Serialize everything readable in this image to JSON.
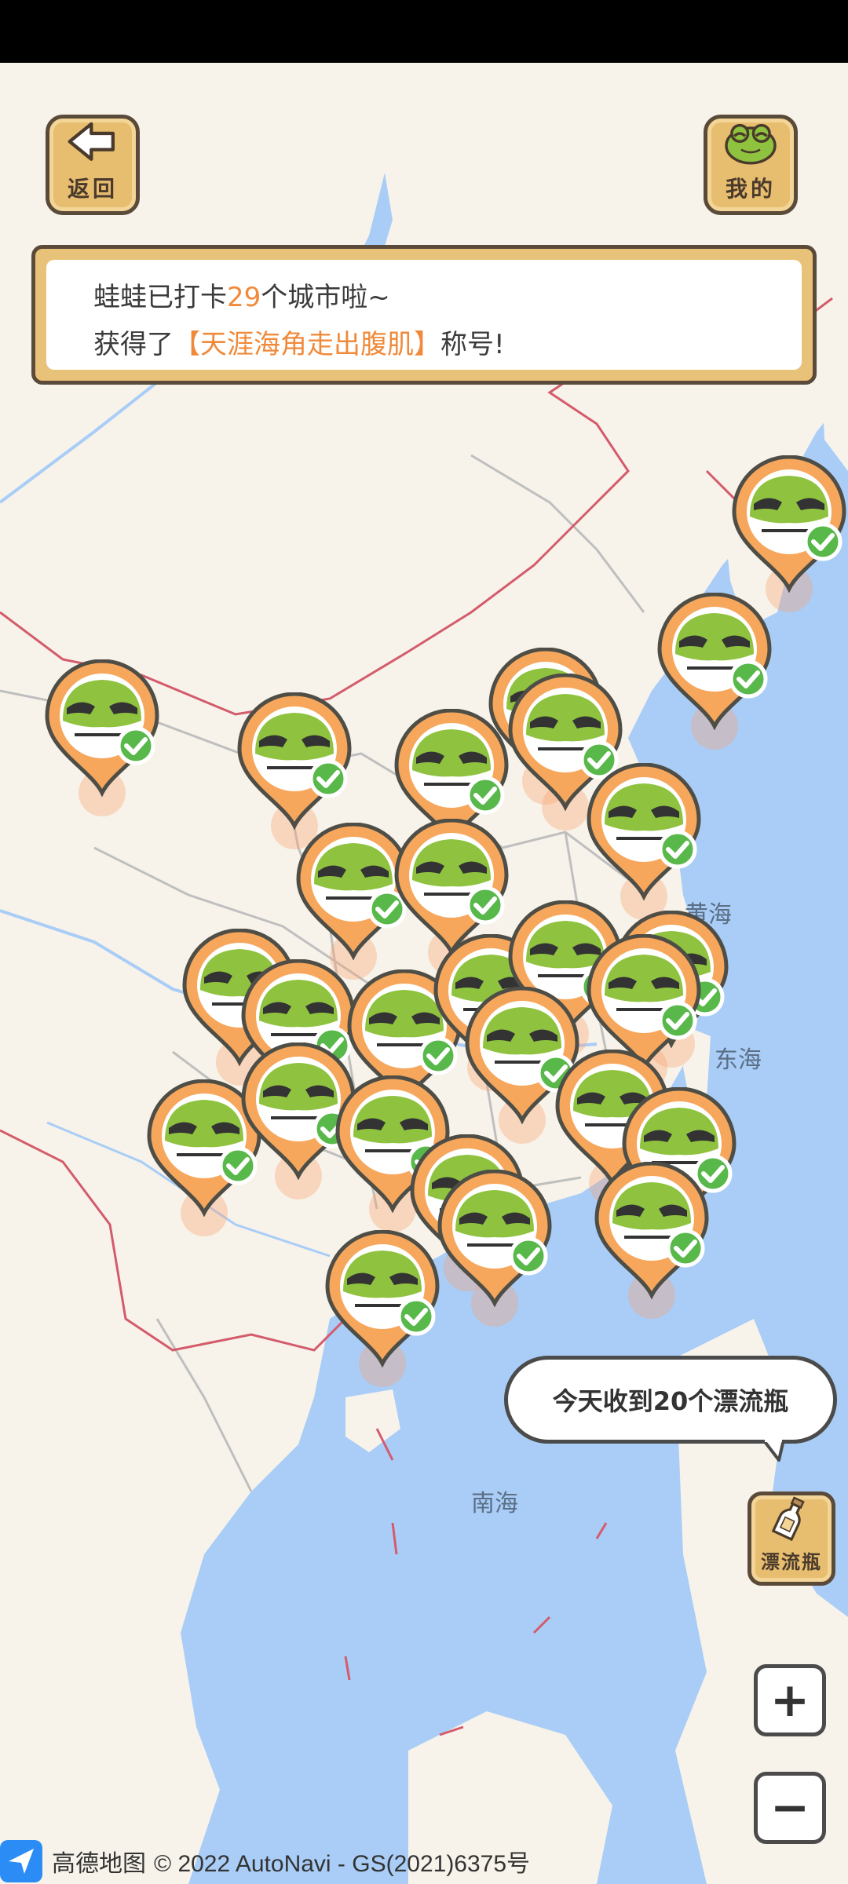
{
  "header": {
    "back_label": "返回",
    "mine_label": "我的"
  },
  "banner": {
    "line1_prefix": "蛙蛙已打卡",
    "line1_count": "29",
    "line1_suffix": "个城市啦~",
    "line2_prefix": "获得了",
    "line2_title": "【天涯海角走出腹肌】",
    "line2_suffix": "称号!"
  },
  "map_labels": {
    "yellow_sea": "黄海",
    "east_sea": "东海",
    "south_sea": "南海"
  },
  "drift": {
    "bubble_text": "今天收到20个漂流瓶",
    "button_label": "漂流瓶"
  },
  "zoom": {
    "in_label": "+",
    "out_label": "−"
  },
  "attribution": {
    "logo_text": "高德地图",
    "copyright": "© 2022 AutoNavi - GS(2021)6375号"
  },
  "colors": {
    "pin_orange": "#f6a75c",
    "frog_green": "#8fc33f",
    "check_green": "#58b84a",
    "wood": "#e7bd70",
    "land": "#f7f3ea",
    "sea": "#a9cdf7",
    "border_red": "#d45b6b"
  }
}
